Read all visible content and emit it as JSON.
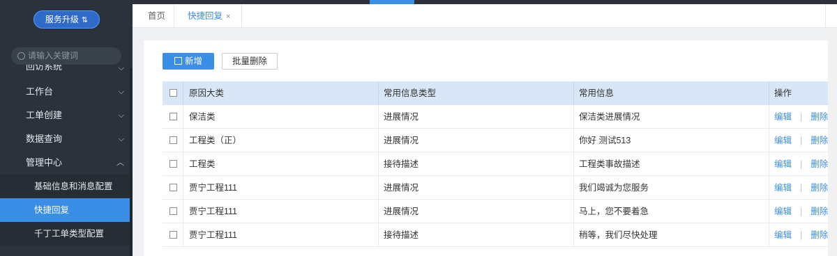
{
  "sidebar": {
    "upgrade_label": "服务升级",
    "upgrade_icon": "sort-arrows-icon",
    "search_placeholder": "请输入关键词",
    "partial_item": "回访系统",
    "items": [
      {
        "label": "工作台"
      },
      {
        "label": "工单创建"
      },
      {
        "label": "数据查询"
      },
      {
        "label": "管理中心"
      }
    ],
    "sub_items": [
      {
        "label": "基础信息和消息配置"
      },
      {
        "label": "快捷回复",
        "active": true
      },
      {
        "label": "千丁工单类型配置"
      }
    ]
  },
  "tabs": {
    "home": "首页",
    "active": "快捷回复",
    "close": "×"
  },
  "toolbar": {
    "add_label": "新增",
    "batch_delete_label": "批量删除"
  },
  "table": {
    "headers": {
      "reason": "原因大类",
      "type": "常用信息类型",
      "message": "常用信息",
      "ops": "操作"
    },
    "edit_label": "编辑",
    "delete_label": "删除",
    "separator": "|",
    "rows": [
      {
        "reason": "保洁类",
        "type": "进展情况",
        "message": "保洁类进展情况"
      },
      {
        "reason": "工程类（正）",
        "type": "进展情况",
        "message": "你好 测试513"
      },
      {
        "reason": "工程类",
        "type": "接待描述",
        "message": "工程类事故描述"
      },
      {
        "reason": "贾宁工程111",
        "type": "进展情况",
        "message": "我们竭诚为您服务"
      },
      {
        "reason": "贾宁工程111",
        "type": "进展情况",
        "message": "马上，您不要着急"
      },
      {
        "reason": "贾宁工程111",
        "type": "接待描述",
        "message": "稍等，我们尽快处理"
      }
    ]
  },
  "colors": {
    "accent": "#3a8ee6",
    "sidebar_bg": "#2b323b",
    "header_row": "#d9e6f7"
  }
}
